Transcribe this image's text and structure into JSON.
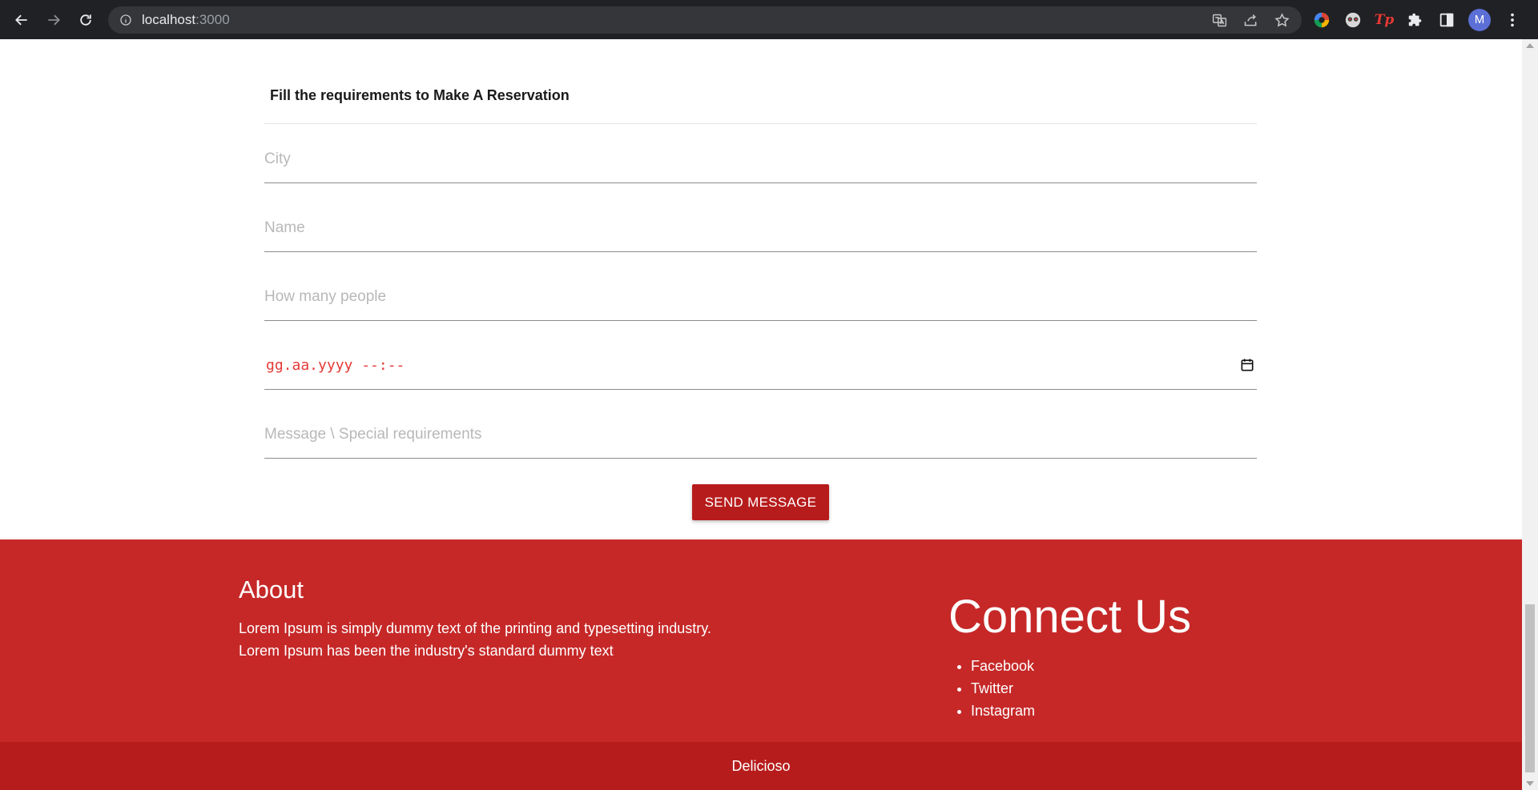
{
  "browser": {
    "url_host": "localhost",
    "url_port": ":3000",
    "profile_initial": "M",
    "extension_tp_label": "Tp"
  },
  "form": {
    "heading": "Fill the requirements to Make A Reservation",
    "city_placeholder": "City",
    "name_placeholder": "Name",
    "people_placeholder": "How many people",
    "datetime_value": "gg.aa.yyyy --:--",
    "message_placeholder": "Message \\ Special requirements",
    "submit_label": "SEND MESSAGE"
  },
  "footer": {
    "about_title": "About",
    "about_line1": "Lorem Ipsum is simply dummy text of the printing and typesetting industry.",
    "about_line2": "Lorem Ipsum has been the industry's standard dummy text",
    "connect_title": "Connect Us",
    "social": [
      "Facebook",
      "Twitter",
      "Instagram"
    ],
    "brand": "Delicioso"
  },
  "colors": {
    "footer_bg": "#c62828",
    "footer_bottom_bg": "#b71c1c",
    "button_bg": "#b71c1c",
    "date_text": "#e53935"
  }
}
